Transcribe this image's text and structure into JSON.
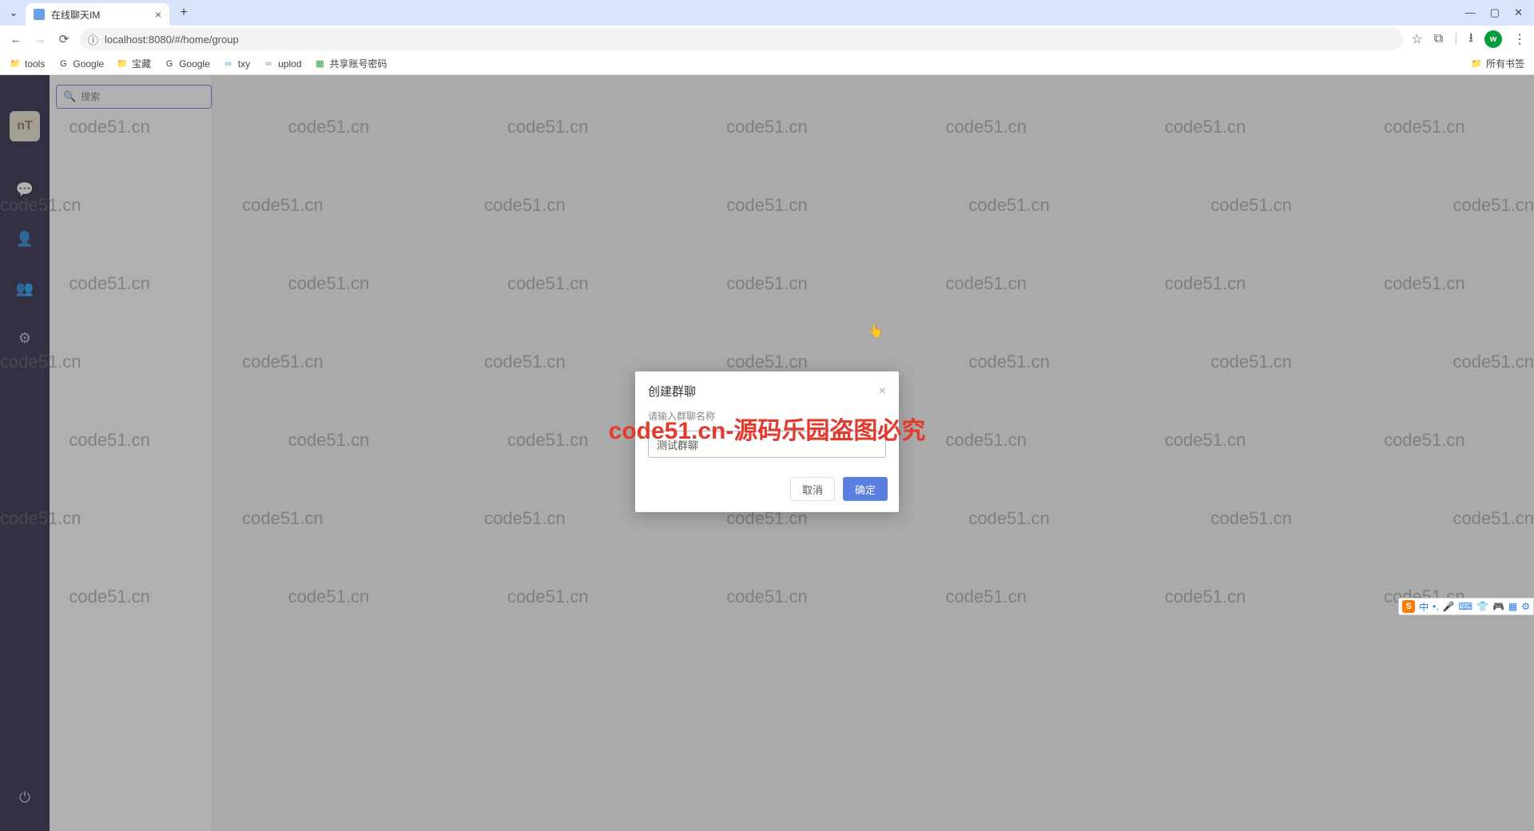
{
  "browser": {
    "tab_title": "在线聊天IM",
    "url": "localhost:8080/#/home/group",
    "avatar_letter": "w",
    "all_bookmarks": "所有书签"
  },
  "bookmarks": [
    {
      "icon": "📁",
      "label": "tools"
    },
    {
      "icon": "G",
      "label": "Google"
    },
    {
      "icon": "📁",
      "label": "宝藏"
    },
    {
      "icon": "G",
      "label": "Google"
    },
    {
      "icon": "∞",
      "label": "txy"
    },
    {
      "icon": "∞",
      "label": "uplod"
    },
    {
      "icon": "▦",
      "label": "共享账号密码"
    }
  ],
  "sidebar": {
    "avatar_text": "nT"
  },
  "search": {
    "placeholder": "搜索"
  },
  "modal": {
    "title": "创建群聊",
    "label": "请输入群聊名称",
    "value": "测试群聊",
    "cancel": "取消",
    "ok": "确定"
  },
  "ime": {
    "lang": "中"
  },
  "watermark": {
    "text": "code51.cn",
    "banner": "code51.cn-源码乐园盗图必究"
  }
}
